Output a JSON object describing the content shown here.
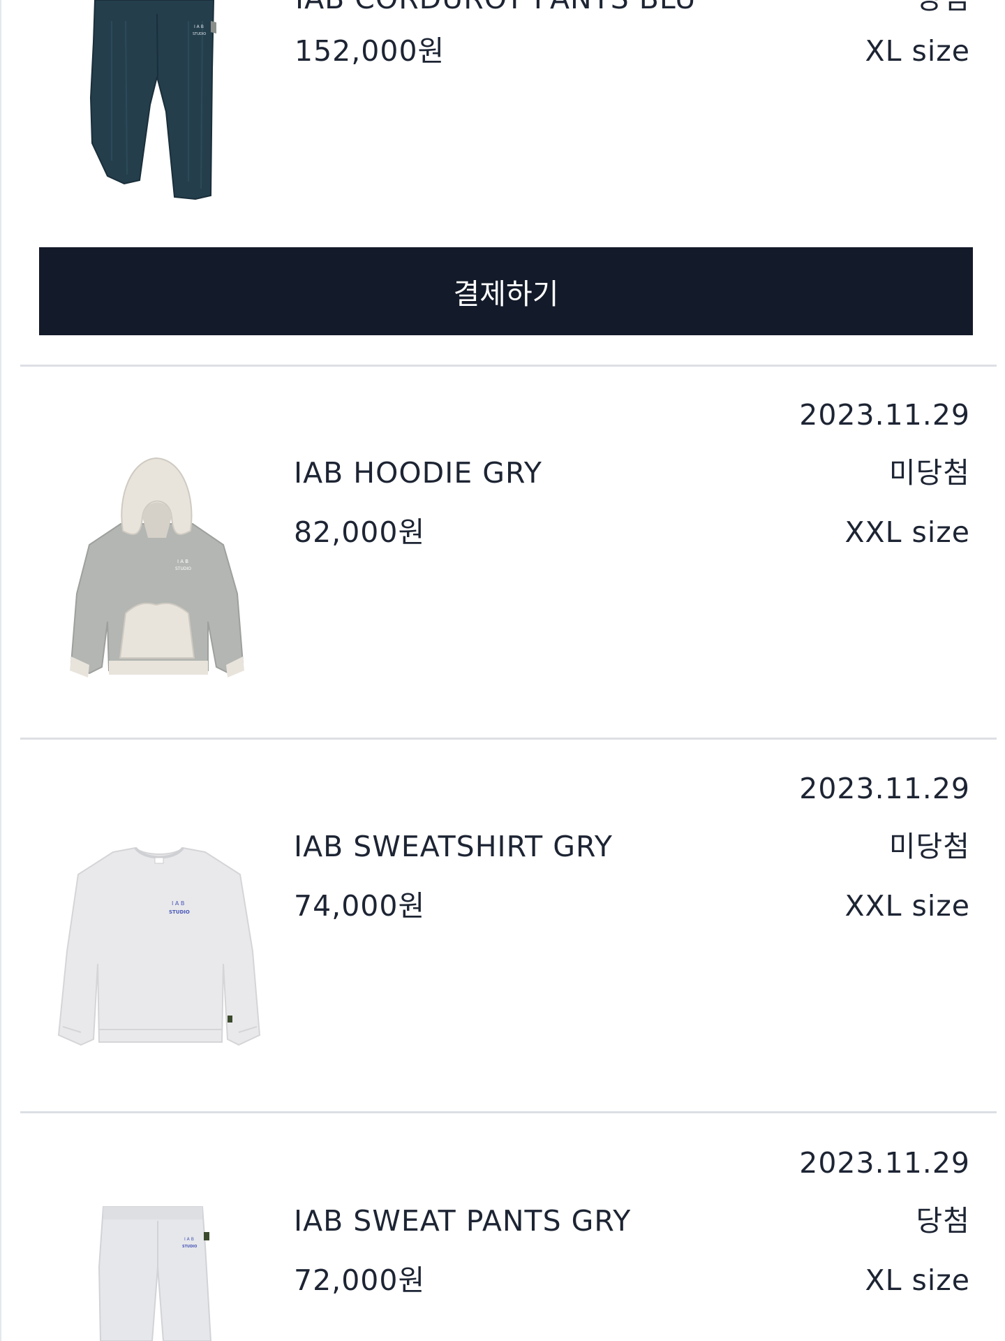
{
  "items": [
    {
      "name": "IAB CORDUROY PANTS BLU",
      "price": "152,000원",
      "status": "당첨",
      "size": "XL size"
    },
    {
      "date": "2023.11.29",
      "name": "IAB HOODIE GRY",
      "price": "82,000원",
      "status": "미당첨",
      "size": "XXL size"
    },
    {
      "date": "2023.11.29",
      "name": "IAB SWEATSHIRT GRY",
      "price": "74,000원",
      "status": "미당첨",
      "size": "XXL size"
    },
    {
      "date": "2023.11.29",
      "name": "IAB SWEAT PANTS GRY",
      "price": "72,000원",
      "status": "당첨",
      "size": "XL size"
    }
  ],
  "pay_button_label": "결제하기",
  "logo_text": {
    "letters": "I A B",
    "studio": "STUDIO"
  },
  "colors": {
    "button_bg": "#131a29",
    "text": "#1d2433",
    "divider": "#dcdfe4"
  }
}
